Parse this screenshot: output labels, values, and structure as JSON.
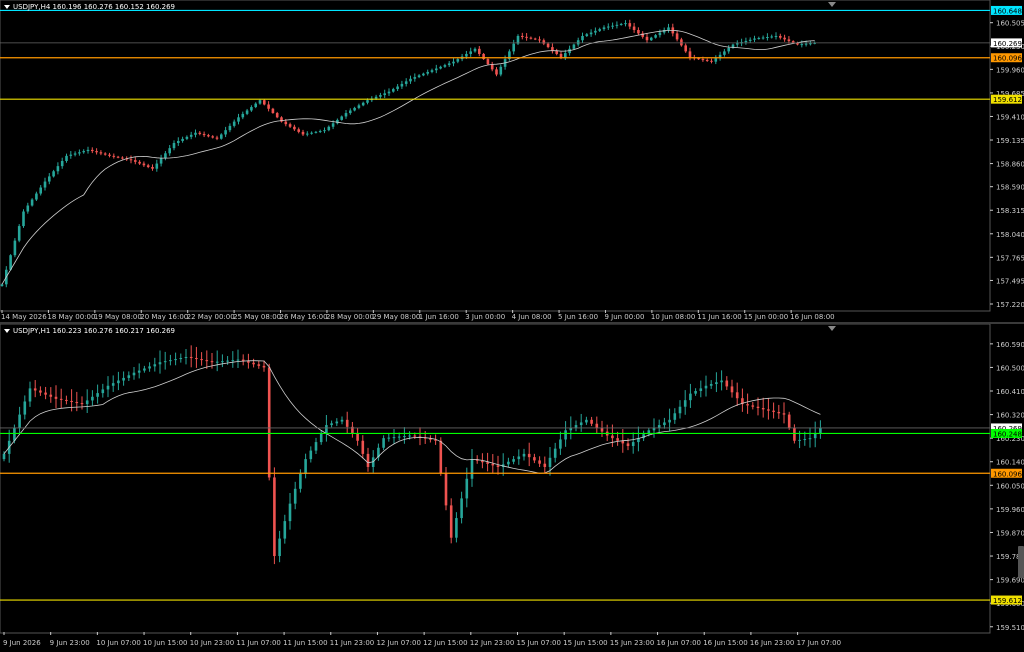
{
  "colors": {
    "bull": "#26a69a",
    "bear": "#ef5350",
    "ma": "#d0d0d0",
    "grid": "#404040",
    "axis": "#cccccc",
    "cyan": "#00e5ff",
    "orange": "#ff9800",
    "yellow": "#f0e000",
    "green": "#00ff00",
    "gray": "#666666"
  },
  "panes": [
    {
      "id": "h4",
      "header": "USDJPY,H4  160.196 160.276 160.152 160.269",
      "price_min": 157.15,
      "price_max": 160.7,
      "price_ticks": [
        "160.505",
        "160.230",
        "159.960",
        "159.685",
        "159.410",
        "159.135",
        "158.860",
        "158.590",
        "158.315",
        "158.040",
        "157.765",
        "157.495",
        "157.220"
      ],
      "levels": [
        {
          "label": "160.648",
          "value": 160.648,
          "color": "#00e5ff",
          "text": "#000"
        },
        {
          "label": "160.269",
          "value": 160.269,
          "color": "#666666",
          "text": "#000",
          "axis_bg": "#ffffff"
        },
        {
          "label": "160.096",
          "value": 160.096,
          "color": "#ff9800",
          "text": "#000"
        },
        {
          "label": "159.612",
          "value": 159.612,
          "color": "#f0e000",
          "text": "#000"
        }
      ],
      "time_labels": [
        "14 May 2026",
        "18 May 00:00",
        "19 May 08:00",
        "20 May 16:00",
        "22 May 00:00",
        "25 May 08:00",
        "26 May 16:00",
        "28 May 00:00",
        "29 May 08:00",
        "1 Jun 16:00",
        "3 Jun 00:00",
        "4 Jun 08:00",
        "5 Jun 16:00",
        "9 Jun 00:00",
        "10 Jun 08:00",
        "11 Jun 16:00",
        "15 Jun 00:00",
        "16 Jun 08:00"
      ],
      "anchors": [
        [
          0,
          157.45
        ],
        [
          5,
          158.3
        ],
        [
          10,
          158.65
        ],
        [
          15,
          158.95
        ],
        [
          20,
          159.02
        ],
        [
          25,
          158.95
        ],
        [
          30,
          158.9
        ],
        [
          35,
          158.8
        ],
        [
          40,
          159.1
        ],
        [
          45,
          159.22
        ],
        [
          50,
          159.15
        ],
        [
          55,
          159.4
        ],
        [
          60,
          159.6
        ],
        [
          65,
          159.35
        ],
        [
          70,
          159.2
        ],
        [
          75,
          159.25
        ],
        [
          80,
          159.45
        ],
        [
          85,
          159.6
        ],
        [
          90,
          159.7
        ],
        [
          95,
          159.85
        ],
        [
          100,
          159.95
        ],
        [
          105,
          160.05
        ],
        [
          110,
          160.2
        ],
        [
          115,
          159.9
        ],
        [
          120,
          160.35
        ],
        [
          125,
          160.3
        ],
        [
          130,
          160.1
        ],
        [
          135,
          160.35
        ],
        [
          140,
          160.45
        ],
        [
          145,
          160.5
        ],
        [
          150,
          160.3
        ],
        [
          155,
          160.45
        ],
        [
          160,
          160.1
        ],
        [
          165,
          160.05
        ],
        [
          170,
          160.25
        ],
        [
          175,
          160.32
        ],
        [
          180,
          160.35
        ],
        [
          185,
          160.25
        ],
        [
          189,
          160.27
        ]
      ]
    },
    {
      "id": "h1",
      "header": "USDJPY,H1  160.223 160.276 160.217 160.269",
      "price_min": 159.49,
      "price_max": 160.62,
      "price_ticks": [
        "160.590",
        "160.500",
        "160.410",
        "160.320",
        "160.230",
        "160.140",
        "160.050",
        "159.960",
        "159.870",
        "159.780",
        "159.690",
        "159.600",
        "159.510"
      ],
      "levels": [
        {
          "label": "160.269",
          "value": 160.269,
          "color": "#666666",
          "text": "#000",
          "axis_bg": "#ffffff"
        },
        {
          "label": "160.248",
          "value": 160.248,
          "color": "#00ff00",
          "text": "#000"
        },
        {
          "label": "160.096",
          "value": 160.096,
          "color": "#ff9800",
          "text": "#000"
        },
        {
          "label": "159.612",
          "value": 159.612,
          "color": "#f0e000",
          "text": "#000"
        }
      ],
      "time_labels": [
        "9 Jun 2026",
        "9 Jun 23:00",
        "10 Jun 07:00",
        "10 Jun 15:00",
        "10 Jun 23:00",
        "11 Jun 07:00",
        "11 Jun 15:00",
        "11 Jun 23:00",
        "12 Jun 07:00",
        "12 Jun 15:00",
        "12 Jun 23:00",
        "15 Jun 07:00",
        "15 Jun 15:00",
        "15 Jun 23:00",
        "16 Jun 07:00",
        "16 Jun 15:00",
        "16 Jun 23:00",
        "17 Jun 07:00"
      ],
      "anchors": [
        [
          0,
          160.17
        ],
        [
          5,
          160.42
        ],
        [
          10,
          160.38
        ],
        [
          15,
          160.36
        ],
        [
          20,
          160.43
        ],
        [
          25,
          160.48
        ],
        [
          30,
          160.52
        ],
        [
          35,
          160.54
        ],
        [
          40,
          160.52
        ],
        [
          45,
          160.53
        ],
        [
          50,
          160.5
        ],
        [
          51,
          160.08
        ],
        [
          52,
          159.78
        ],
        [
          55,
          159.98
        ],
        [
          58,
          160.15
        ],
        [
          62,
          160.28
        ],
        [
          65,
          160.3
        ],
        [
          68,
          160.22
        ],
        [
          70,
          160.12
        ],
        [
          73,
          160.23
        ],
        [
          78,
          160.24
        ],
        [
          83,
          160.22
        ],
        [
          86,
          159.85
        ],
        [
          90,
          160.15
        ],
        [
          95,
          160.12
        ],
        [
          100,
          160.17
        ],
        [
          104,
          160.12
        ],
        [
          108,
          160.26
        ],
        [
          112,
          160.3
        ],
        [
          116,
          160.24
        ],
        [
          120,
          160.2
        ],
        [
          124,
          160.26
        ],
        [
          128,
          160.3
        ],
        [
          132,
          160.4
        ],
        [
          135,
          160.43
        ],
        [
          138,
          160.45
        ],
        [
          142,
          160.36
        ],
        [
          146,
          160.34
        ],
        [
          150,
          160.32
        ],
        [
          152,
          160.22
        ],
        [
          155,
          160.23
        ],
        [
          157,
          160.27
        ]
      ]
    }
  ]
}
